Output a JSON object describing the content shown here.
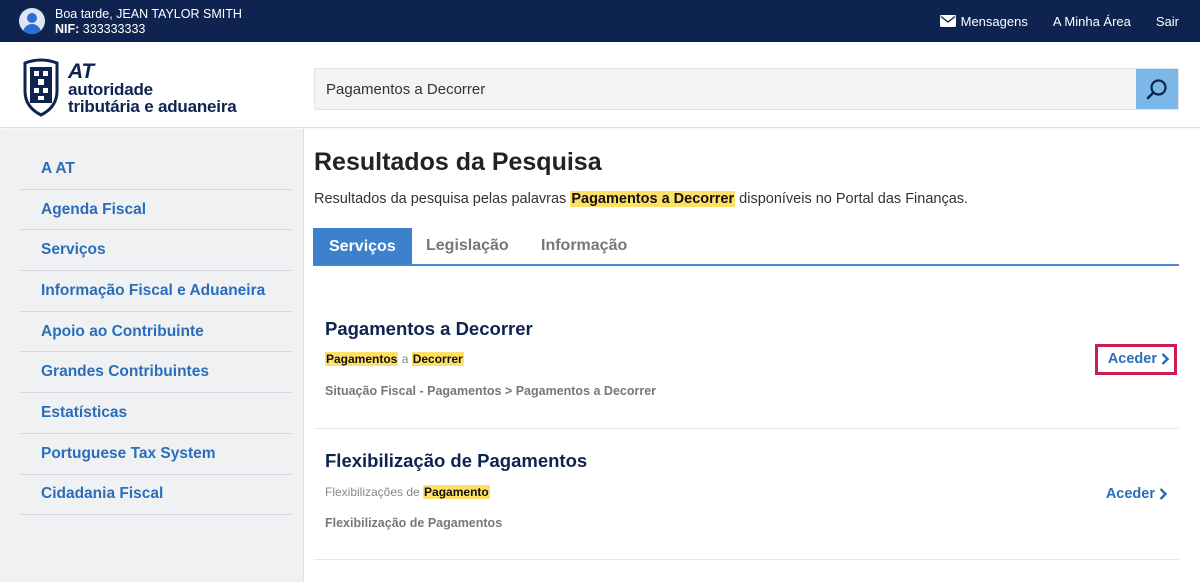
{
  "topbar": {
    "greeting": "Boa tarde,  JEAN TAYLOR SMITH",
    "nif_label": "NIF:",
    "nif_value": "333333333",
    "links": {
      "messages": "Mensagens",
      "my_area": "A Minha Área",
      "logout": "Sair"
    }
  },
  "logo": {
    "line1": "AT",
    "line2": "autoridade",
    "line3": "tributária e aduaneira"
  },
  "search": {
    "value": "Pagamentos a Decorrer"
  },
  "sidebar": {
    "items": [
      {
        "label": "A AT"
      },
      {
        "label": "Agenda Fiscal"
      },
      {
        "label": "Serviços"
      },
      {
        "label": "Informação Fiscal e Aduaneira"
      },
      {
        "label": "Apoio ao Contribuinte"
      },
      {
        "label": "Grandes Contribuintes"
      },
      {
        "label": "Estatísticas"
      },
      {
        "label": "Portuguese Tax System"
      },
      {
        "label": "Cidadania Fiscal"
      }
    ]
  },
  "main": {
    "title": "Resultados da Pesquisa",
    "intro_before": "Resultados da pesquisa pelas palavras ",
    "intro_term": "Pagamentos a Decorrer",
    "intro_after": " disponíveis no Portal das Finanças.",
    "tabs": [
      {
        "label": "Serviços"
      },
      {
        "label": "Legislação"
      },
      {
        "label": "Informação"
      }
    ],
    "results": [
      {
        "title": "Pagamentos a Decorrer",
        "snippet_hl1": "Pagamentos",
        "snippet_mid": " a ",
        "snippet_hl2": "Decorrer",
        "path": "Situação Fiscal - Pagamentos > Pagamentos a Decorrer",
        "action": "Aceder"
      },
      {
        "title": "Flexibilização de Pagamentos",
        "snippet_pre": "Flexibilizações de ",
        "snippet_hl1": "Pagamento",
        "path": "Flexibilização de Pagamentos",
        "action": "Aceder"
      }
    ]
  },
  "colors": {
    "topbar_bg": "#0e2350",
    "link_blue": "#2a6ebb",
    "highlight": "#ffe066",
    "tab_active": "#3d80cc",
    "focus_border": "#cf1d4f"
  }
}
